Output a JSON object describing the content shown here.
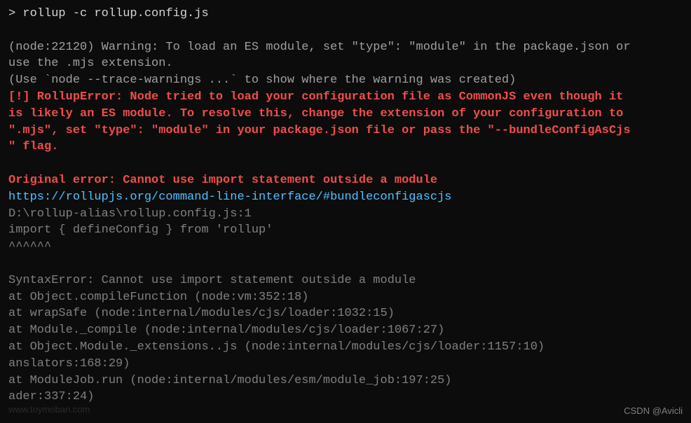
{
  "prompt": {
    "symbol": ">",
    "command": "rollup -c rollup.config.js"
  },
  "warning": {
    "line1": "(node:22120) Warning: To load an ES module, set \"type\": \"module\" in the package.json or",
    "line2": " use the .mjs extension.",
    "line3": "(Use `node --trace-warnings ...` to show where the warning was created)"
  },
  "error": {
    "line1": "[!] RollupError: Node tried to load your configuration file as CommonJS even though it",
    "line2": " is likely an ES module. To resolve this, change the extension of your configuration to ",
    "line3": "\".mjs\", set \"type\": \"module\" in your package.json file or pass the \"--bundleConfigAsCjs",
    "line4": "\" flag."
  },
  "original_error": "Original error: Cannot use import statement outside a module",
  "link": "https://rollupjs.org/command-line-interface/#bundleconfigascjs",
  "file_ref": "D:\\rollup-alias\\rollup.config.js:1",
  "source_line": "import { defineConfig } from 'rollup'",
  "carets": "^^^^^^",
  "stack": {
    "line1": "SyntaxError: Cannot use import statement outside a module",
    "line2": "    at Object.compileFunction (node:vm:352:18)",
    "line3": "    at wrapSafe (node:internal/modules/cjs/loader:1032:15)",
    "line4": "    at Module._compile (node:internal/modules/cjs/loader:1067:27)",
    "line5": "    at Object.Module._extensions..js (node:internal/modules/cjs/loader:1157:10)",
    "line6": "anslators:168:29)",
    "line7": "    at ModuleJob.run (node:internal/modules/esm/module_job:197:25)",
    "line8": "ader:337:24)"
  },
  "watermark": "CSDN @Avicli",
  "faint_bg": "www.toymoban.com"
}
